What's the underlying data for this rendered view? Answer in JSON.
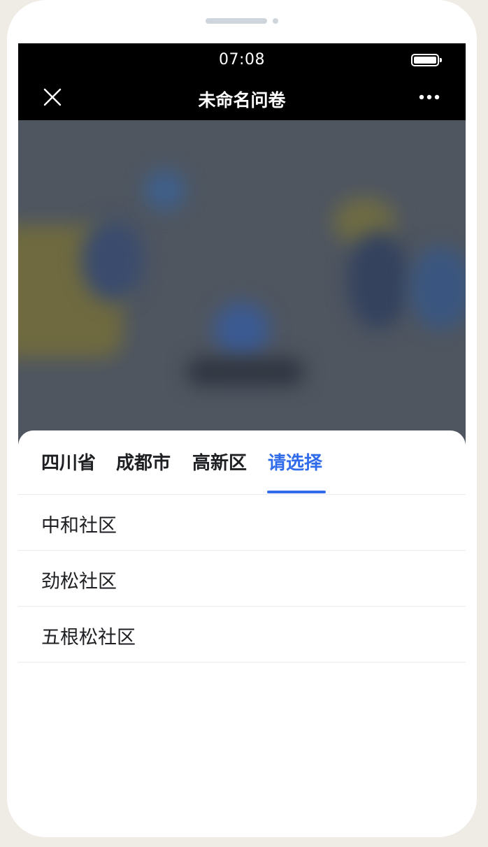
{
  "status_bar": {
    "time": "07:08"
  },
  "nav": {
    "title": "未命名问卷"
  },
  "picker": {
    "tabs": [
      {
        "label": "四川省",
        "active": false
      },
      {
        "label": "成都市",
        "active": false
      },
      {
        "label": "高新区",
        "active": false
      },
      {
        "label": "请选择",
        "active": true
      }
    ],
    "options": [
      {
        "label": "中和社区"
      },
      {
        "label": "劲松社区"
      },
      {
        "label": "五根松社区"
      }
    ]
  },
  "colors": {
    "accent": "#2f6bea",
    "nav_background": "#000000",
    "overlay": "#4f5660"
  },
  "icons": {
    "nav_close": "close-icon",
    "nav_more": "more-icon",
    "battery": "battery-icon",
    "sheet_close": "close-icon"
  }
}
